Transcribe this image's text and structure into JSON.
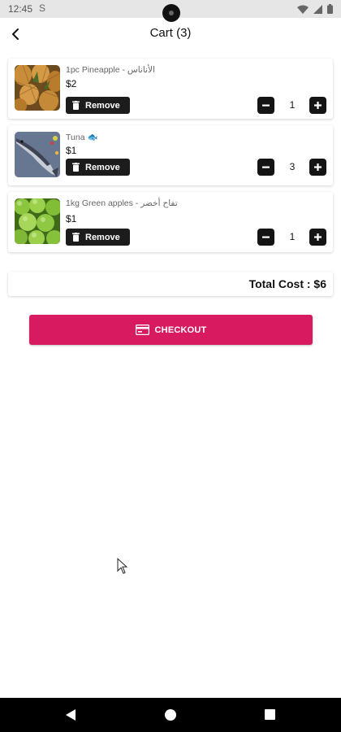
{
  "status_bar": {
    "time": "12:45",
    "notification_icon": "S",
    "icons": [
      "wifi-icon",
      "signal-icon",
      "battery-icon"
    ]
  },
  "app_bar": {
    "back_icon": "arrow-back-icon",
    "title": "Cart (3)"
  },
  "cart": {
    "items": [
      {
        "name": "1pc Pineapple - الأناناس",
        "price": "$2",
        "quantity": "1",
        "remove_label": "Remove",
        "image": "pineapple-image"
      },
      {
        "name": "Tuna 🐟",
        "price": "$1",
        "quantity": "3",
        "remove_label": "Remove",
        "image": "tuna-image"
      },
      {
        "name": "1kg Green apples - تفاح أخضر",
        "price": "$1",
        "quantity": "1",
        "remove_label": "Remove",
        "image": "green-apples-image"
      }
    ]
  },
  "total": {
    "label": "Total Cost : $6"
  },
  "checkout": {
    "label": "CHECKOUT",
    "icon": "credit-card-icon"
  },
  "nav_bar": {
    "icons": [
      "nav-back-icon",
      "nav-home-icon",
      "nav-recents-icon"
    ]
  },
  "colors": {
    "accent": "#d81b60",
    "button_dark": "#1c1c1c",
    "status_bar": "#e6e6e6"
  }
}
